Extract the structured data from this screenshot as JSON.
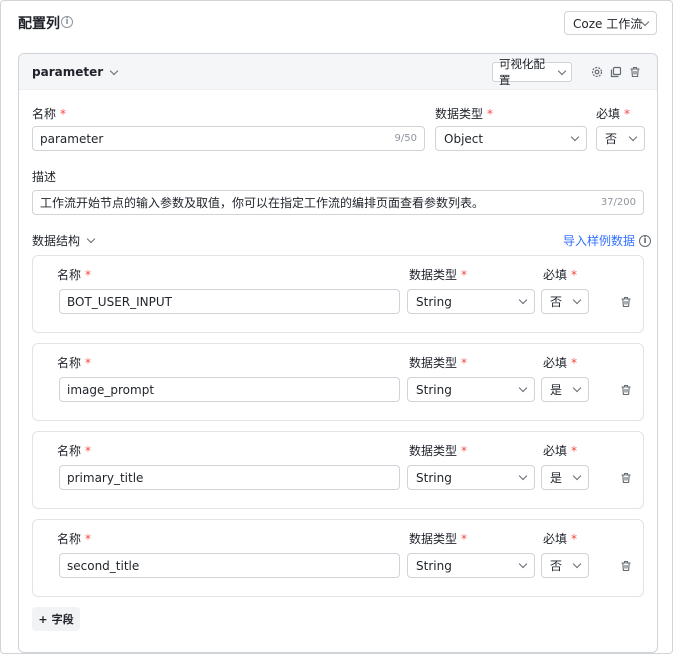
{
  "header": {
    "title": "配置列",
    "source_select": "Coze 工作流"
  },
  "param": {
    "name_header": "parameter",
    "view_mode": "可视化配置",
    "name_label": "名称",
    "name_value": "parameter",
    "name_count": "9/50",
    "type_label": "数据类型",
    "type_value": "Object",
    "required_label": "必填",
    "required_value": "否",
    "desc_label": "描述",
    "desc_value": "工作流开始节点的输入参数及取值，你可以在指定工作流的编排页面查看参数列表。",
    "desc_count": "37/200",
    "struct_label": "数据结构",
    "import_link": "导入样例数据"
  },
  "fields": [
    {
      "name_label": "名称",
      "name": "BOT_USER_INPUT",
      "type_label": "数据类型",
      "type": "String",
      "required_label": "必填",
      "required": "否"
    },
    {
      "name_label": "名称",
      "name": "image_prompt",
      "type_label": "数据类型",
      "type": "String",
      "required_label": "必填",
      "required": "是"
    },
    {
      "name_label": "名称",
      "name": "primary_title",
      "type_label": "数据类型",
      "type": "String",
      "required_label": "必填",
      "required": "是"
    },
    {
      "name_label": "名称",
      "name": "second_title",
      "type_label": "数据类型",
      "type": "String",
      "required_label": "必填",
      "required": "否"
    }
  ],
  "add_field_label": "字段",
  "icons": {
    "info": "info-icon",
    "chevron": "chevron-down-icon",
    "settings": "gear-icon",
    "copy": "copy-icon",
    "delete": "trash-icon",
    "add": "plus-icon"
  },
  "colors": {
    "required": "#f54a45",
    "link": "#3370ff",
    "border": "#d0d3d8"
  }
}
